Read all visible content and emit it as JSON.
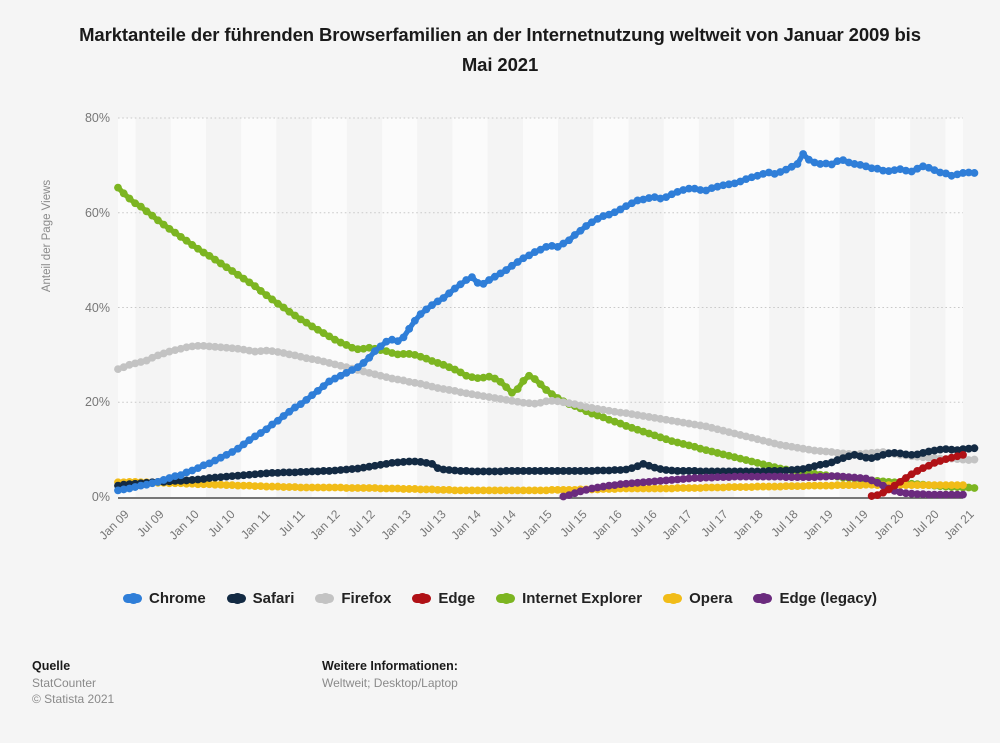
{
  "title": "Marktanteile der führenden Browserfamilien an der Internetnutzung weltweit von Januar 2009 bis Mai 2021",
  "axis": {
    "ylabel": "Anteil der Page Views",
    "yticks": [
      "0%",
      "20%",
      "40%",
      "60%",
      "80%"
    ]
  },
  "legend": [
    {
      "label": "Chrome",
      "color": "#2f7ed8"
    },
    {
      "label": "Safari",
      "color": "#132a43"
    },
    {
      "label": "Firefox",
      "color": "#c3c3c3"
    },
    {
      "label": "Edge",
      "color": "#b01116"
    },
    {
      "label": "Internet Explorer",
      "color": "#7cb521"
    },
    {
      "label": "Opera",
      "color": "#f1bc18"
    },
    {
      "label": "Edge (legacy)",
      "color": "#6b2b7e"
    }
  ],
  "footer": {
    "source_heading": "Quelle",
    "source_name": "StatCounter",
    "copyright": "© Statista 2021",
    "info_heading": "Weitere Informationen:",
    "info_text": "Weltweit; Desktop/Laptop"
  },
  "chart_data": {
    "type": "line",
    "title": "Marktanteile der führenden Browserfamilien an der Internetnutzung weltweit von Januar 2009 bis Mai 2021",
    "xlabel": "",
    "ylabel": "Anteil der Page Views",
    "ylim": [
      0,
      80
    ],
    "yticks": [
      0,
      20,
      40,
      60,
      80
    ],
    "grid": true,
    "legend_position": "bottom",
    "x_tick_labels": [
      "Jan 09",
      "Jul 09",
      "Jan 10",
      "Jul 10",
      "Jan 11",
      "Jul 11",
      "Jan 12",
      "Jul 12",
      "Jan 13",
      "Jul 13",
      "Jan 14",
      "Jul 14",
      "Jan 15",
      "Jul 15",
      "Jan 16",
      "Jul 16",
      "Jan 17",
      "Jul 17",
      "Jan 18",
      "Jul 18",
      "Jan 19",
      "Jul 19",
      "Jan 20",
      "Jul 20",
      "Jan 21"
    ],
    "x_start": "Jan 2009",
    "x_end": "Mai 2021",
    "x_count": 149,
    "series": [
      {
        "name": "Chrome",
        "color": "#2f7ed8",
        "start_index": 0,
        "values": [
          1.4,
          1.6,
          1.8,
          2.1,
          2.4,
          2.6,
          2.9,
          3.2,
          3.6,
          4.0,
          4.4,
          4.6,
          5.2,
          5.6,
          6.1,
          6.7,
          7.1,
          7.7,
          8.3,
          8.9,
          9.5,
          10.2,
          11.1,
          12.0,
          12.8,
          13.5,
          14.3,
          15.3,
          16.1,
          17.1,
          18.0,
          18.9,
          19.6,
          20.5,
          21.5,
          22.4,
          23.4,
          24.4,
          25.0,
          25.6,
          26.2,
          26.8,
          27.4,
          28.3,
          29.4,
          30.8,
          31.8,
          32.8,
          33.2,
          32.9,
          33.7,
          35.5,
          37.2,
          38.6,
          39.6,
          40.5,
          41.3,
          42.0,
          43.0,
          44.0,
          44.9,
          45.8,
          46.4,
          45.2,
          45.0,
          45.8,
          46.5,
          47.2,
          47.9,
          48.8,
          49.6,
          50.4,
          51.0,
          51.7,
          52.2,
          52.8,
          53.0,
          52.8,
          53.5,
          54.2,
          55.3,
          56.2,
          57.2,
          58.0,
          58.7,
          59.3,
          59.6,
          60.1,
          60.7,
          61.4,
          62.0,
          62.6,
          62.8,
          63.1,
          63.3,
          63.0,
          63.3,
          63.9,
          64.4,
          64.8,
          65.1,
          65.1,
          64.8,
          64.7,
          65.2,
          65.5,
          65.8,
          66.0,
          66.2,
          66.6,
          67.1,
          67.5,
          67.8,
          68.2,
          68.5,
          68.2,
          68.6,
          69.1,
          69.7,
          70.3,
          72.4,
          71.2,
          70.6,
          70.3,
          70.4,
          70.2,
          70.9,
          71.1,
          70.6,
          70.3,
          70.1,
          69.8,
          69.4,
          69.3,
          68.9,
          68.8,
          69.0,
          69.2,
          68.9,
          68.7,
          69.3,
          69.8,
          69.5,
          69.0,
          68.5,
          68.3,
          67.8,
          68.1,
          68.4,
          68.5,
          68.4
        ],
        "label_first": 1.4,
        "label_last": 68.4,
        "peak": 72.4
      },
      {
        "name": "Safari",
        "color": "#132a43",
        "start_index": 0,
        "values": [
          2.4,
          2.6,
          2.7,
          2.8,
          2.9,
          3.0,
          3.1,
          3.2,
          3.2,
          3.3,
          3.4,
          3.4,
          3.5,
          3.6,
          3.7,
          3.8,
          4.0,
          4.1,
          4.2,
          4.3,
          4.4,
          4.5,
          4.6,
          4.7,
          4.8,
          4.9,
          5.0,
          5.1,
          5.1,
          5.2,
          5.2,
          5.2,
          5.3,
          5.3,
          5.4,
          5.4,
          5.5,
          5.5,
          5.6,
          5.7,
          5.8,
          5.9,
          6.0,
          6.2,
          6.4,
          6.6,
          6.8,
          7.0,
          7.2,
          7.3,
          7.4,
          7.5,
          7.5,
          7.4,
          7.2,
          7.0,
          6.1,
          5.8,
          5.7,
          5.6,
          5.5,
          5.5,
          5.4,
          5.4,
          5.4,
          5.4,
          5.4,
          5.4,
          5.5,
          5.5,
          5.5,
          5.5,
          5.5,
          5.5,
          5.5,
          5.5,
          5.5,
          5.5,
          5.5,
          5.5,
          5.5,
          5.5,
          5.5,
          5.5,
          5.6,
          5.6,
          5.6,
          5.7,
          5.7,
          5.8,
          6.1,
          6.5,
          7.0,
          6.6,
          6.2,
          5.9,
          5.7,
          5.6,
          5.5,
          5.5,
          5.5,
          5.5,
          5.4,
          5.4,
          5.4,
          5.4,
          5.4,
          5.4,
          5.4,
          5.4,
          5.4,
          5.4,
          5.4,
          5.4,
          5.5,
          5.5,
          5.5,
          5.6,
          5.7,
          5.8,
          5.9,
          6.2,
          6.5,
          6.8,
          7.0,
          7.3,
          7.8,
          8.2,
          8.6,
          8.9,
          8.6,
          8.3,
          8.2,
          8.5,
          8.9,
          9.2,
          9.3,
          9.2,
          9.0,
          8.9,
          9.0,
          9.3,
          9.6,
          9.8,
          10.0,
          10.1,
          10.0,
          9.9,
          10.1,
          10.2,
          10.3
        ],
        "label_last": 10.3
      },
      {
        "name": "Firefox",
        "color": "#c3c3c3",
        "start_index": 0,
        "values": [
          27.0,
          27.4,
          27.9,
          28.2,
          28.5,
          28.8,
          29.4,
          29.9,
          30.3,
          30.7,
          31.0,
          31.3,
          31.6,
          31.8,
          31.9,
          31.9,
          31.8,
          31.7,
          31.6,
          31.5,
          31.4,
          31.3,
          31.1,
          30.9,
          30.7,
          30.8,
          30.9,
          30.8,
          30.6,
          30.4,
          30.1,
          29.9,
          29.6,
          29.3,
          29.1,
          28.9,
          28.6,
          28.3,
          28.0,
          27.7,
          27.4,
          27.1,
          26.8,
          26.5,
          26.2,
          25.9,
          25.6,
          25.3,
          25.0,
          24.8,
          24.6,
          24.3,
          24.1,
          23.9,
          23.6,
          23.3,
          23.0,
          22.8,
          22.6,
          22.4,
          22.1,
          21.9,
          21.7,
          21.5,
          21.3,
          21.1,
          20.9,
          20.7,
          20.5,
          20.3,
          20.1,
          19.9,
          19.8,
          19.7,
          19.9,
          20.2,
          20.3,
          20.2,
          20.0,
          19.8,
          19.6,
          19.3,
          19.0,
          18.8,
          18.6,
          18.4,
          18.2,
          18.0,
          17.8,
          17.7,
          17.5,
          17.3,
          17.1,
          16.9,
          16.7,
          16.5,
          16.3,
          16.1,
          15.9,
          15.7,
          15.5,
          15.3,
          15.1,
          14.9,
          14.6,
          14.3,
          14.0,
          13.7,
          13.4,
          13.1,
          12.8,
          12.5,
          12.2,
          11.9,
          11.6,
          11.3,
          11.0,
          10.8,
          10.6,
          10.4,
          10.2,
          10.0,
          9.8,
          9.7,
          9.6,
          9.5,
          9.3,
          9.2,
          9.1,
          9.0,
          9.1,
          9.2,
          9.3,
          9.4,
          9.5,
          9.3,
          9.1,
          8.9,
          8.8,
          8.6,
          8.5,
          8.4,
          8.3,
          8.2,
          8.1,
          8.0,
          8.1,
          8.0,
          7.9,
          7.8,
          7.9
        ],
        "label_first": 27.0,
        "label_last": 7.9,
        "peak": 31.9
      },
      {
        "name": "Edge",
        "color": "#b01116",
        "start_index": 132,
        "values": [
          0.2,
          0.4,
          0.9,
          1.6,
          2.4,
          3.2,
          4.0,
          4.8,
          5.5,
          6.1,
          6.6,
          7.2,
          7.6,
          8.0,
          8.3,
          8.6,
          8.9
        ],
        "start_label": "Jan 2020",
        "label_last": 8.9
      },
      {
        "name": "Internet Explorer",
        "color": "#7cb521",
        "start_index": 0,
        "values": [
          65.3,
          64.1,
          63.0,
          62.0,
          61.3,
          60.3,
          59.4,
          58.4,
          57.5,
          56.6,
          55.8,
          54.9,
          54.1,
          53.2,
          52.4,
          51.6,
          50.9,
          50.1,
          49.3,
          48.5,
          47.7,
          46.9,
          46.1,
          45.3,
          44.5,
          43.5,
          42.6,
          41.7,
          40.8,
          40.0,
          39.1,
          38.3,
          37.5,
          36.8,
          36.0,
          35.3,
          34.6,
          33.9,
          33.2,
          32.6,
          32.1,
          31.5,
          31.2,
          31.3,
          31.5,
          31.3,
          31.0,
          30.8,
          30.4,
          30.1,
          30.2,
          30.2,
          30.0,
          29.6,
          29.2,
          28.7,
          28.3,
          27.9,
          27.4,
          26.9,
          26.3,
          25.6,
          25.3,
          25.1,
          25.2,
          25.4,
          25.0,
          24.3,
          23.2,
          22.0,
          22.8,
          24.5,
          25.6,
          24.9,
          23.8,
          22.6,
          21.7,
          20.9,
          20.2,
          19.6,
          19.2,
          18.7,
          18.1,
          17.6,
          17.2,
          16.8,
          16.3,
          15.9,
          15.5,
          15.0,
          14.6,
          14.2,
          13.8,
          13.4,
          13.0,
          12.6,
          12.2,
          11.8,
          11.5,
          11.2,
          10.9,
          10.6,
          10.2,
          9.9,
          9.6,
          9.3,
          9.0,
          8.7,
          8.4,
          8.1,
          7.8,
          7.5,
          7.2,
          6.9,
          6.6,
          6.3,
          6.0,
          5.8,
          5.6,
          5.4,
          5.2,
          5.1,
          4.9,
          4.7,
          4.6,
          4.4,
          4.3,
          4.1,
          4.0,
          3.9,
          3.8,
          3.6,
          3.5,
          3.4,
          3.3,
          3.2,
          3.1,
          3.0,
          2.9,
          2.8,
          2.7,
          2.6,
          2.5,
          2.4,
          2.3,
          2.2,
          2.1,
          2.1,
          2.0,
          2.0,
          1.9
        ],
        "label_first": 65.3,
        "label_last": 1.9
      },
      {
        "name": "Opera",
        "color": "#f1bc18",
        "start_index": 0,
        "values": [
          3.1,
          3.1,
          3.2,
          3.2,
          3.1,
          3.1,
          3.0,
          3.0,
          3.0,
          2.9,
          2.9,
          2.9,
          2.8,
          2.8,
          2.7,
          2.7,
          2.7,
          2.6,
          2.6,
          2.5,
          2.5,
          2.4,
          2.4,
          2.4,
          2.3,
          2.3,
          2.2,
          2.2,
          2.2,
          2.1,
          2.1,
          2.1,
          2.0,
          2.0,
          2.0,
          2.0,
          2.0,
          2.0,
          2.0,
          2.0,
          1.9,
          1.9,
          1.9,
          1.9,
          1.9,
          1.9,
          1.8,
          1.8,
          1.8,
          1.8,
          1.7,
          1.7,
          1.7,
          1.6,
          1.6,
          1.6,
          1.5,
          1.5,
          1.5,
          1.4,
          1.4,
          1.4,
          1.4,
          1.4,
          1.4,
          1.4,
          1.4,
          1.4,
          1.4,
          1.4,
          1.4,
          1.4,
          1.4,
          1.4,
          1.4,
          1.4,
          1.5,
          1.5,
          1.5,
          1.5,
          1.5,
          1.6,
          1.6,
          1.6,
          1.6,
          1.7,
          1.7,
          1.7,
          1.8,
          1.8,
          1.8,
          1.8,
          1.8,
          1.8,
          1.8,
          1.8,
          1.8,
          1.8,
          1.9,
          1.9,
          1.9,
          1.9,
          1.9,
          2.0,
          2.0,
          2.0,
          2.0,
          2.1,
          2.1,
          2.1,
          2.1,
          2.1,
          2.2,
          2.2,
          2.2,
          2.2,
          2.2,
          2.3,
          2.3,
          2.3,
          2.3,
          2.4,
          2.4,
          2.4,
          2.4,
          2.4,
          2.5,
          2.5,
          2.5,
          2.5,
          2.5,
          2.6,
          2.6,
          2.5,
          2.5,
          2.5,
          2.5,
          2.5,
          2.5,
          2.5,
          2.5,
          2.5,
          2.5,
          2.5,
          2.5,
          2.5,
          2.5,
          2.5,
          2.5
        ],
        "label_first": 3.1,
        "label_last": 2.5
      },
      {
        "name": "Edge (legacy)",
        "color": "#6b2b7e",
        "start_index": 78,
        "values": [
          0.1,
          0.4,
          0.8,
          1.2,
          1.5,
          1.8,
          2.0,
          2.2,
          2.4,
          2.5,
          2.7,
          2.8,
          2.9,
          3.0,
          3.1,
          3.2,
          3.3,
          3.4,
          3.5,
          3.6,
          3.7,
          3.8,
          3.9,
          4.0,
          4.0,
          4.1,
          4.1,
          4.2,
          4.2,
          4.2,
          4.3,
          4.3,
          4.3,
          4.3,
          4.3,
          4.3,
          4.3,
          4.3,
          4.3,
          4.2,
          4.2,
          4.2,
          4.2,
          4.2,
          4.2,
          4.3,
          4.3,
          4.4,
          4.4,
          4.3,
          4.2,
          4.1,
          4.0,
          3.9,
          3.5,
          3.0,
          2.4,
          1.8,
          1.3,
          1.0,
          0.8,
          0.7,
          0.6,
          0.6,
          0.5,
          0.5,
          0.5,
          0.5,
          0.5,
          0.5,
          0.5
        ],
        "start_label": "Jul 2015",
        "label_last": 0.5,
        "peak": 4.4
      }
    ]
  }
}
